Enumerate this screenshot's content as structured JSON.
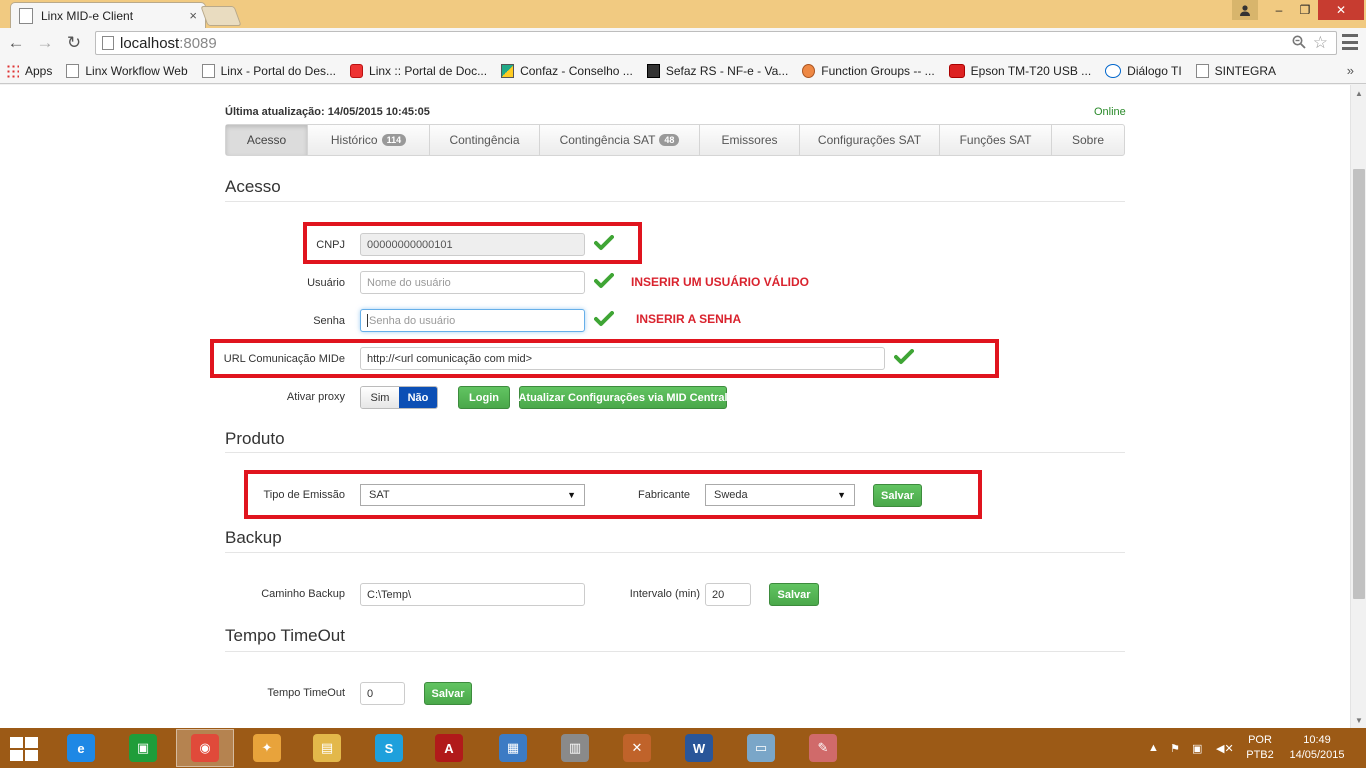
{
  "browser": {
    "tab_title": "Linx MID-e Client",
    "tab_close": "×",
    "url_host": "localhost",
    "url_port": ":8089",
    "window_controls": {
      "minimize": "–",
      "maximize": "❐",
      "close": "✕"
    },
    "nav": {
      "back": "←",
      "forward": "→",
      "reload": "↻"
    },
    "bookmarks": [
      {
        "label": "Apps",
        "icon": "apps-grid-icon"
      },
      {
        "label": "Linx Workflow Web",
        "icon": "page-icon"
      },
      {
        "label": "Linx - Portal do Des...",
        "icon": "page-icon"
      },
      {
        "label": "Linx :: Portal de Doc...",
        "icon": "linx-icon"
      },
      {
        "label": "Confaz - Conselho ...",
        "icon": "flag-icon"
      },
      {
        "label": "Sefaz RS - NF-e - Va...",
        "icon": "sefaz-icon"
      },
      {
        "label": "Function Groups -- ...",
        "icon": "fox-icon"
      },
      {
        "label": "Epson TM-T20 USB ...",
        "icon": "youtube-icon"
      },
      {
        "label": "Diálogo TI",
        "icon": "intel-icon"
      },
      {
        "label": "SINTEGRA",
        "icon": "page-icon"
      }
    ],
    "bookmarks_more": "»"
  },
  "header": {
    "last_update_label": "Última atualização:",
    "last_update_value": "14/05/2015 10:45:05",
    "status": "Online"
  },
  "tabs": [
    {
      "label": "Acesso",
      "badge": ""
    },
    {
      "label": "Histórico",
      "badge": "114"
    },
    {
      "label": "Contingência",
      "badge": ""
    },
    {
      "label": "Contingência SAT",
      "badge": "48"
    },
    {
      "label": "Emissores",
      "badge": ""
    },
    {
      "label": "Configurações SAT",
      "badge": ""
    },
    {
      "label": "Funções SAT",
      "badge": ""
    },
    {
      "label": "Sobre",
      "badge": ""
    }
  ],
  "acesso": {
    "title": "Acesso",
    "cnpj_label": "CNPJ",
    "cnpj_value": "00000000000101",
    "usuario_label": "Usuário",
    "usuario_placeholder": "Nome do usuário",
    "usuario_annotation": "INSERIR UM USUÁRIO VÁLIDO",
    "senha_label": "Senha",
    "senha_placeholder": "Senha do usuário",
    "senha_annotation": "INSERIR A SENHA",
    "url_label": "URL Comunicação MIDe",
    "url_value": "http://<url comunicação com mid>",
    "proxy_label": "Ativar proxy",
    "proxy_sim": "Sim",
    "proxy_nao": "Não",
    "login_button": "Login",
    "update_button": "Atualizar Configurações via MID Central"
  },
  "produto": {
    "title": "Produto",
    "tipo_label": "Tipo de Emissão",
    "tipo_value": "SAT",
    "fabricante_label": "Fabricante",
    "fabricante_value": "Sweda",
    "save_button": "Salvar"
  },
  "backup": {
    "title": "Backup",
    "caminho_label": "Caminho Backup",
    "caminho_value": "C:\\Temp\\",
    "intervalo_label": "Intervalo (min)",
    "intervalo_value": "20",
    "save_button": "Salvar"
  },
  "timeout": {
    "title": "Tempo TimeOut",
    "label": "Tempo TimeOut",
    "value": "0",
    "save_button": "Salvar"
  },
  "taskbar": {
    "apps": [
      {
        "name": "ie-icon",
        "letter": "e",
        "color": "#1e88e5"
      },
      {
        "name": "store-icon",
        "letter": "▣",
        "color": "#1f9d3a"
      },
      {
        "name": "chrome-icon",
        "letter": "◉",
        "color": "#e04a3a"
      },
      {
        "name": "fox-app-icon",
        "letter": "✦",
        "color": "#e8a33b"
      },
      {
        "name": "explorer-icon",
        "letter": "▤",
        "color": "#e3b84a"
      },
      {
        "name": "skype-icon",
        "letter": "S",
        "color": "#1ea0dc"
      },
      {
        "name": "acrobat-icon",
        "letter": "A",
        "color": "#b11a1a"
      },
      {
        "name": "control-panel-icon",
        "letter": "▦",
        "color": "#3c7bc4"
      },
      {
        "name": "device-icon",
        "letter": "▥",
        "color": "#8a8a8a"
      },
      {
        "name": "xmind-icon",
        "letter": "✕",
        "color": "#c0632a"
      },
      {
        "name": "word-icon",
        "letter": "W",
        "color": "#2a5699"
      },
      {
        "name": "notepad-icon",
        "letter": "▭",
        "color": "#7aa6c8"
      },
      {
        "name": "paint-icon",
        "letter": "✎",
        "color": "#d06a6a"
      }
    ],
    "language_top": "POR",
    "language_bottom": "PTB2",
    "time": "10:49",
    "date": "14/05/2015"
  }
}
